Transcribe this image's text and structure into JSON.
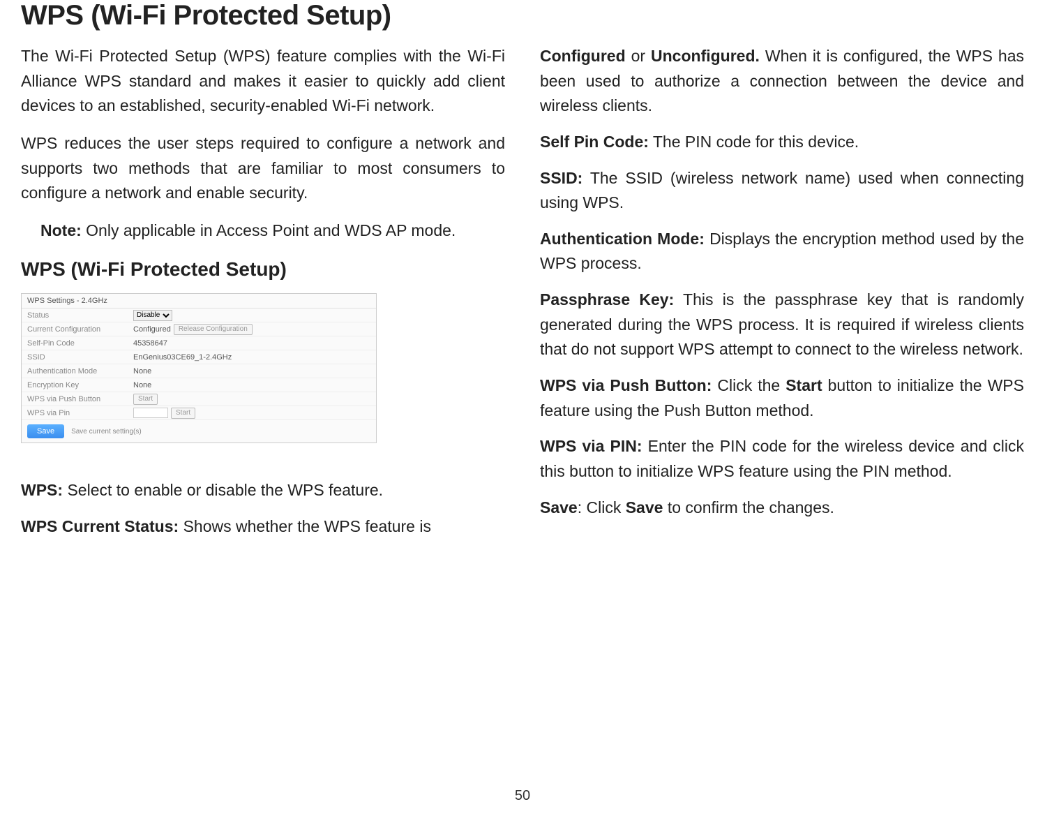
{
  "page_title": "WPS (Wi-Fi Protected Setup)",
  "col1": {
    "para1": "The Wi-Fi Protected Setup (WPS) feature complies with the Wi-Fi Alliance WPS standard and makes it easier to quickly add client devices to an established, security-enabled Wi-Fi network.",
    "para2": "WPS reduces the user steps required to configure a network and supports two methods that are familiar to most consumers to configure a network and enable security.",
    "note_label": "Note:",
    "note_text": " Only applicable in Access Point and WDS AP mode.",
    "section_heading": "WPS (Wi-Fi Protected Setup)",
    "screenshot": {
      "header": "WPS Settings - 2.4GHz",
      "rows": {
        "status_label": "Status",
        "status_value": "Disable",
        "current_config_label": "Current Configuration",
        "current_config_value": "Configured",
        "release_btn": "Release Configuration",
        "self_pin_label": "Self-Pin Code",
        "self_pin_value": "45358647",
        "ssid_label": "SSID",
        "ssid_value": "EnGenius03CE69_1-2.4GHz",
        "auth_mode_label": "Authentication Mode",
        "auth_mode_value": "None",
        "enc_key_label": "Encryption Key",
        "enc_key_value": "None",
        "push_btn_label": "WPS via Push Button",
        "push_btn_value": "Start",
        "pin_label": "WPS via Pin",
        "pin_btn": "Start"
      },
      "save_btn": "Save",
      "save_caption": "Save current setting(s)"
    },
    "def_wps_label": "WPS:",
    "def_wps_text": " Select to enable or disable the WPS feature.",
    "def_status_label": "WPS Current Status:",
    "def_status_text": " Shows whether the WPS feature is "
  },
  "col2": {
    "status_cont_bold1": "Configured",
    "status_cont_mid": " or ",
    "status_cont_bold2": "Unconfigured.",
    "status_cont_text": " When it is configured, the WPS has been used to authorize a connection between the device and wireless clients.",
    "self_pin_label": "Self Pin Code:",
    "self_pin_text": " The PIN code for this device.",
    "ssid_label": "SSID:",
    "ssid_text": " The SSID (wireless network name) used when connecting using WPS.",
    "auth_label": "Authentication Mode:",
    "auth_text": " Displays the encryption method used by the WPS process.",
    "pass_label": "Passphrase Key:",
    "pass_text": " This is the passphrase key that is randomly generated during the WPS process. It is required if wireless clients that do not support WPS attempt to connect to the wireless network.",
    "push_label": "WPS via Push Button:",
    "push_text_a": " Click the ",
    "push_bold": "Start",
    "push_text_b": " button to initialize the WPS feature using the Push Button method.",
    "pin_label": "WPS via PIN:",
    "pin_text": " Enter the PIN code for the wireless device and click this button to initialize WPS feature using the PIN method.",
    "save_label": "Save",
    "save_mid": ": Click ",
    "save_bold": "Save",
    "save_text": " to confirm the changes."
  },
  "page_number": "50"
}
